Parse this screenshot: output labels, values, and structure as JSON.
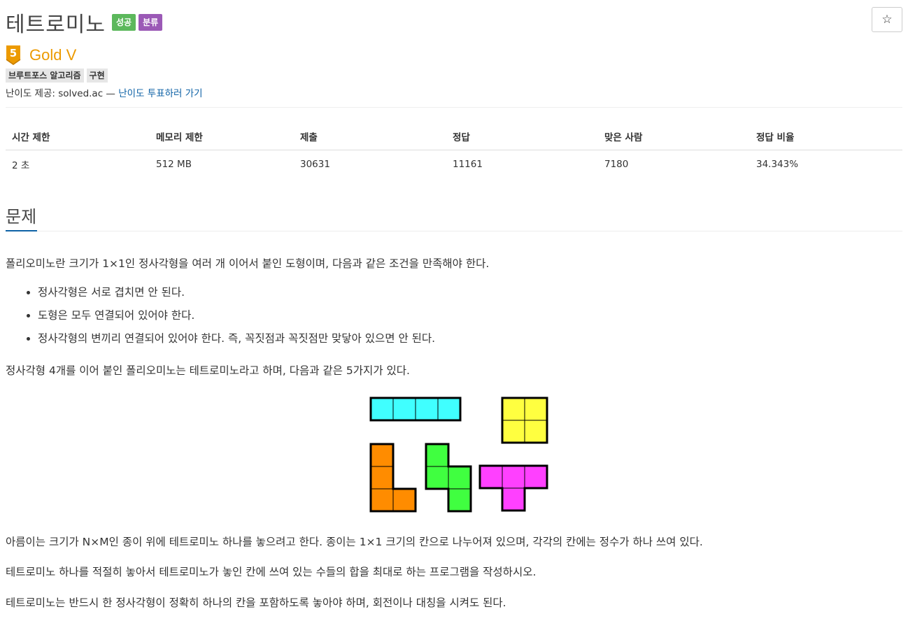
{
  "header": {
    "title": "테트로미노",
    "badges": [
      {
        "label": "성공",
        "color": "#5cb85c"
      },
      {
        "label": "분류",
        "color": "#9b59b6"
      }
    ],
    "star_icon": "star-outline-icon"
  },
  "tier": {
    "level_digit": "5",
    "label": "Gold V",
    "color": "#ec9a00"
  },
  "tags": [
    "브루트포스 알고리즘",
    "구현"
  ],
  "credit": {
    "prefix": "난이도 제공: solved.ac — ",
    "link": "난이도 투표하러 가기"
  },
  "stats": {
    "headers": [
      "시간 제한",
      "메모리 제한",
      "제출",
      "정답",
      "맞은 사람",
      "정답 비율"
    ],
    "values": [
      "2 초",
      "512 MB",
      "30631",
      "11161",
      "7180",
      "34.343%"
    ]
  },
  "problem": {
    "section_title": "문제",
    "intro": "폴리오미노란 크기가 1×1인 정사각형을 여러 개 이어서 붙인 도형이며, 다음과 같은 조건을 만족해야 한다.",
    "rules": [
      "정사각형은 서로 겹치면 안 된다.",
      "도형은 모두 연결되어 있어야 한다.",
      "정사각형의 변끼리 연결되어 있어야 한다. 즉, 꼭짓점과 꼭짓점만 맞닿아 있으면 안 된다."
    ],
    "tetromino_intro": "정사각형 4개를 이어 붙인 폴리오미노는 테트로미노라고 하며, 다음과 같은 5가지가 있다.",
    "tetromino_colors": {
      "I": "#40ffff",
      "O": "#ffff40",
      "L": "#ff8c00",
      "S": "#40ff40",
      "T": "#ff40ff"
    },
    "paragraphs": [
      "아름이는 크기가 N×M인 종이 위에 테트로미노 하나를 놓으려고 한다. 종이는 1×1 크기의 칸으로 나누어져 있으며, 각각의 칸에는 정수가 하나 쓰여 있다.",
      "테트로미노 하나를 적절히 놓아서 테트로미노가 놓인 칸에 쓰여 있는 수들의 합을 최대로 하는 프로그램을 작성하시오.",
      "테트로미노는 반드시 한 정사각형이 정확히 하나의 칸을 포함하도록 놓아야 하며, 회전이나 대칭을 시켜도 된다."
    ]
  }
}
